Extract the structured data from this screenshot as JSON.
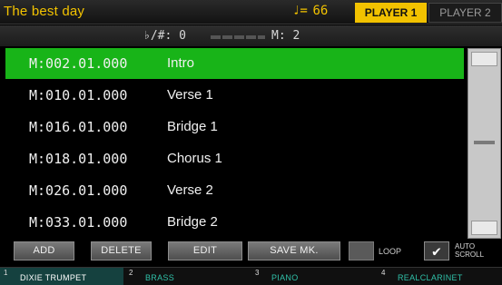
{
  "header": {
    "song_title": "The best day",
    "tempo_symbol": "♩=",
    "tempo_value": "66",
    "player1_label": "PLAYER 1",
    "player2_label": "PLAYER 2",
    "active_color": "#f2c200"
  },
  "info": {
    "transpose": "♭/#: 0",
    "measure": "M:  2"
  },
  "markers": [
    {
      "position": "M:002.01.000",
      "name": "Intro",
      "selected": true
    },
    {
      "position": "M:010.01.000",
      "name": "Verse 1"
    },
    {
      "position": "M:016.01.000",
      "name": "Bridge 1"
    },
    {
      "position": "M:018.01.000",
      "name": "Chorus 1"
    },
    {
      "position": "M:026.01.000",
      "name": "Verse 2"
    },
    {
      "position": "M:033.01.000",
      "name": "Bridge 2"
    }
  ],
  "buttons": {
    "add": "ADD",
    "delete": "DELETE",
    "edit": "EDIT",
    "save": "SAVE MK.",
    "loop_label": "LOOP",
    "auto_scroll_line1": "AUTO",
    "auto_scroll_line2": "SCROLL",
    "auto_scroll_check": "✔"
  },
  "tracks": [
    {
      "num": "1",
      "label": "DIXIE TRUMPET"
    },
    {
      "num": "2",
      "label": "BRASS"
    },
    {
      "num": "3",
      "label": "PIANO"
    },
    {
      "num": "4",
      "label": "REALCLARINET"
    }
  ],
  "colors": {
    "selected_row": "#18b418",
    "track_text": "#2fc0a8"
  }
}
